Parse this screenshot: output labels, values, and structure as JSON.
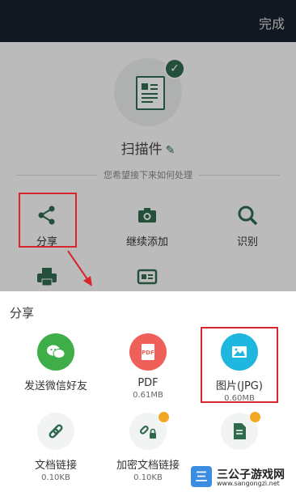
{
  "topbar": {
    "done_label": "完成"
  },
  "document": {
    "name": "扫描件",
    "hint": "您希望接下来如何处理"
  },
  "actions": [
    {
      "label": "分享",
      "icon": "share-icon"
    },
    {
      "label": "继续添加",
      "icon": "camera-icon"
    },
    {
      "label": "识别",
      "icon": "ocr-icon"
    },
    {
      "label": "",
      "icon": "printer-icon"
    },
    {
      "label": "",
      "icon": "id-card-icon"
    }
  ],
  "sheet": {
    "title": "分享",
    "options": [
      {
        "label": "发送微信好友",
        "size": "",
        "icon": "wechat-icon",
        "color": "#3fae49"
      },
      {
        "label": "PDF",
        "size": "0.61MB",
        "icon": "pdf-icon",
        "color": "#f0605b"
      },
      {
        "label": "图片(JPG)",
        "size": "0.60MB",
        "icon": "image-icon",
        "color": "#1fb6e0"
      },
      {
        "label": "文档链接",
        "size": "0.10KB",
        "icon": "link-icon",
        "color": "#2f6a4f"
      },
      {
        "label": "加密文档链接",
        "size": "0.10KB",
        "icon": "lock-link-icon",
        "color": "#2f6a4f"
      },
      {
        "label": "",
        "size": "",
        "icon": "doc-icon",
        "color": "#2f6a4f"
      }
    ]
  },
  "watermark": {
    "name": "三公子游戏网",
    "url": "www.sangongzi.net",
    "logo_text": "三"
  },
  "colors": {
    "accent": "#2f6a4f",
    "highlight": "#d8262c"
  }
}
